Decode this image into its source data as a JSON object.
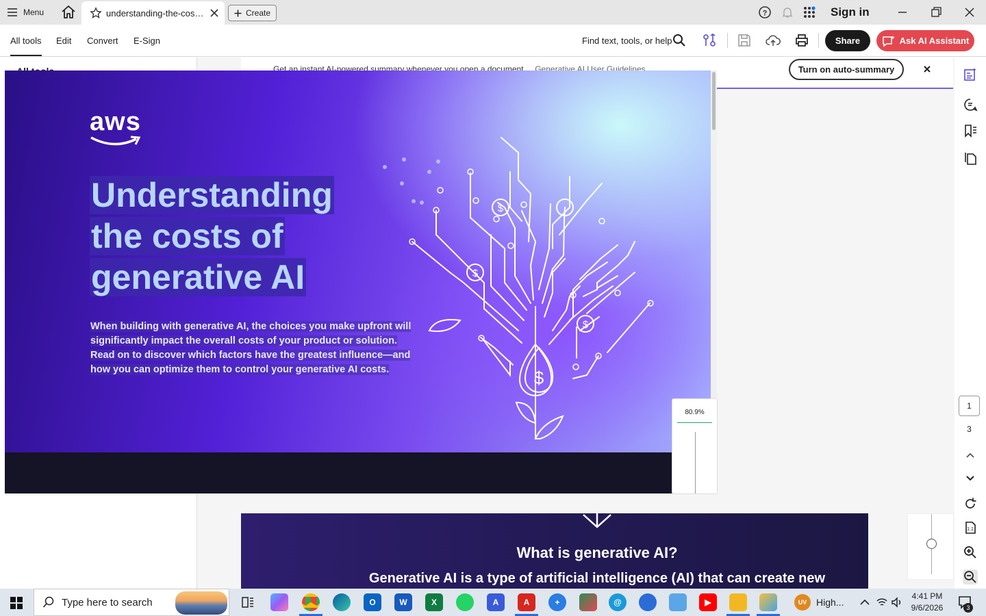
{
  "titlebar": {
    "menu_label": "Menu",
    "tab_title": "understanding-the-costs...",
    "create_label": "Create",
    "signin_label": "Sign in"
  },
  "toolbar": {
    "tabs": [
      "All tools",
      "Edit",
      "Convert",
      "E-Sign"
    ],
    "active_tab": "All tools",
    "find_label": "Find text, tools, or help",
    "share_label": "Share",
    "ai_label": "Ask AI Assistant"
  },
  "left_panel": {
    "title": "All tools"
  },
  "ai_banner": {
    "text": "Get an instant AI-powered summary whenever you open a document.",
    "link": "Generative AI User Guidelines",
    "button": "Turn on auto-summary"
  },
  "document": {
    "logo_text": "aws",
    "title_lines": [
      "Understanding",
      "the costs of",
      "generative AI"
    ],
    "subtitle": "When building with generative AI, the choices you make upfront will significantly impact the overall costs of your product or solution. Read on to discover which factors have the greatest influence—and how you can optimize them to control your generative AI costs.",
    "page2_heading": "What is generative AI?",
    "page2_body": "Generative AI is a type of artificial intelligence (AI) that can create new"
  },
  "zoom": {
    "value": "80.9%"
  },
  "pager": {
    "current": "1",
    "total": "3"
  },
  "taskbar": {
    "search_placeholder": "Type here to search",
    "profile_initials": "UV",
    "profile_label": "High...",
    "time": "4:41 PM",
    "date": "9/6/2026",
    "notification_count": "3"
  },
  "colors": {
    "share_bg": "#1a1a1a",
    "ai_button_bg": "#e34850",
    "cover_dark": "#2a0f86",
    "cover_light": "#cdfffa",
    "title_text": "#b7d6ff"
  }
}
